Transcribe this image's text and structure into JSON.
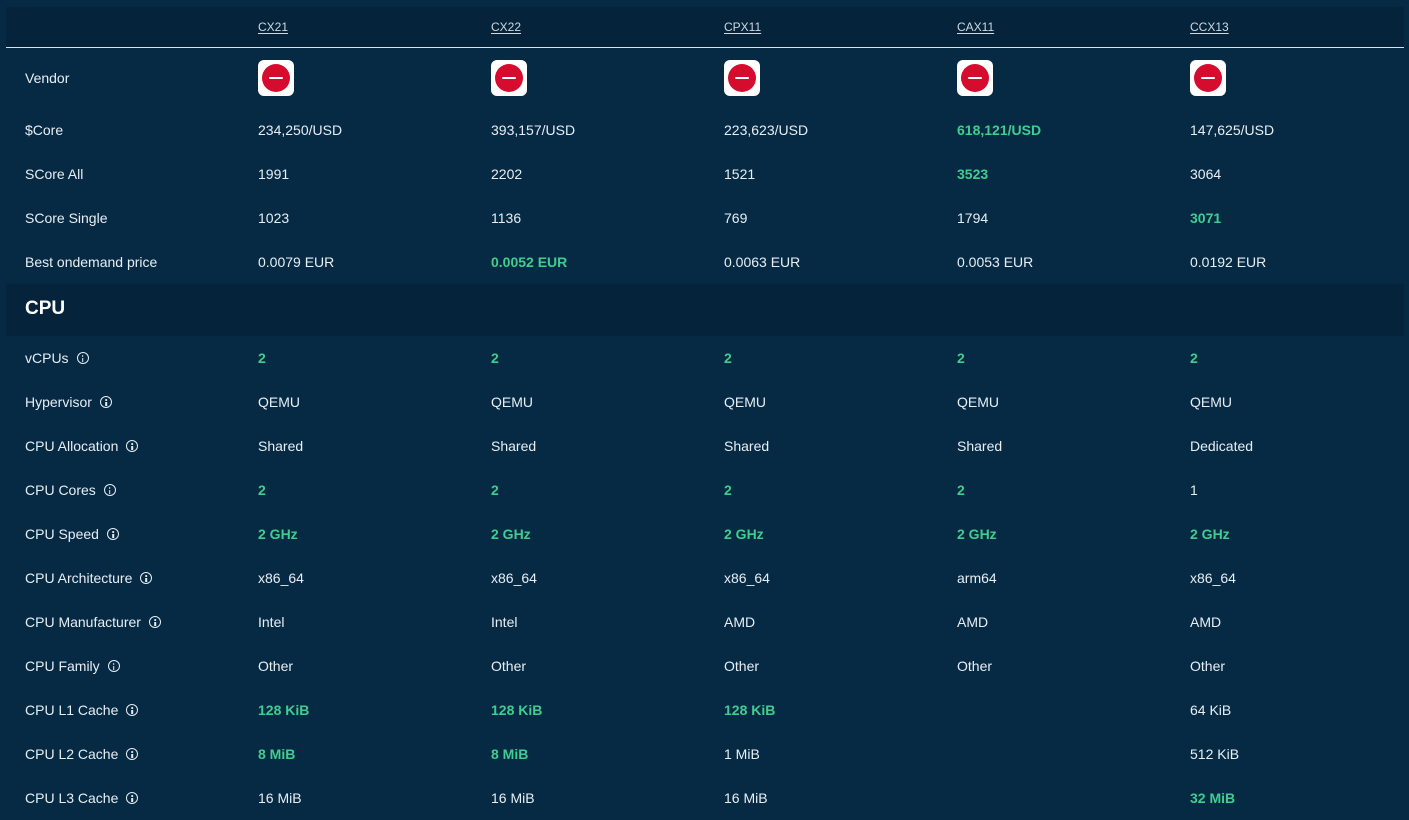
{
  "columns": [
    "CX21",
    "CX22",
    "CPX11",
    "CAX11",
    "CCX13"
  ],
  "vendor": {
    "label": "Vendor",
    "logo": "hetzner-logo",
    "logo_color": "#d50c2d"
  },
  "summary_rows": [
    {
      "label": "$Core",
      "info": false,
      "values": [
        "234,250/USD",
        "393,157/USD",
        "223,623/USD",
        "618,121/USD",
        "147,625/USD"
      ],
      "best": [
        3
      ]
    },
    {
      "label": "SCore All",
      "info": false,
      "values": [
        "1991",
        "2202",
        "1521",
        "3523",
        "3064"
      ],
      "best": [
        3
      ]
    },
    {
      "label": "SCore Single",
      "info": false,
      "values": [
        "1023",
        "1136",
        "769",
        "1794",
        "3071"
      ],
      "best": [
        4
      ]
    },
    {
      "label": "Best ondemand price",
      "info": false,
      "values": [
        "0.0079 EUR",
        "0.0052 EUR",
        "0.0063 EUR",
        "0.0053 EUR",
        "0.0192 EUR"
      ],
      "best": [
        1
      ]
    }
  ],
  "section": {
    "title": "CPU"
  },
  "cpu_rows": [
    {
      "label": "vCPUs",
      "info": true,
      "values": [
        "2",
        "2",
        "2",
        "2",
        "2"
      ],
      "best": [
        0,
        1,
        2,
        3,
        4
      ]
    },
    {
      "label": "Hypervisor",
      "info": true,
      "values": [
        "QEMU",
        "QEMU",
        "QEMU",
        "QEMU",
        "QEMU"
      ],
      "best": []
    },
    {
      "label": "CPU Allocation",
      "info": true,
      "values": [
        "Shared",
        "Shared",
        "Shared",
        "Shared",
        "Dedicated"
      ],
      "best": []
    },
    {
      "label": "CPU Cores",
      "info": true,
      "values": [
        "2",
        "2",
        "2",
        "2",
        "1"
      ],
      "best": [
        0,
        1,
        2,
        3
      ]
    },
    {
      "label": "CPU Speed",
      "info": true,
      "values": [
        "2 GHz",
        "2 GHz",
        "2 GHz",
        "2 GHz",
        "2 GHz"
      ],
      "best": [
        0,
        1,
        2,
        3,
        4
      ]
    },
    {
      "label": "CPU Architecture",
      "info": true,
      "values": [
        "x86_64",
        "x86_64",
        "x86_64",
        "arm64",
        "x86_64"
      ],
      "best": []
    },
    {
      "label": "CPU Manufacturer",
      "info": true,
      "values": [
        "Intel",
        "Intel",
        "AMD",
        "AMD",
        "AMD"
      ],
      "best": []
    },
    {
      "label": "CPU Family",
      "info": true,
      "values": [
        "Other",
        "Other",
        "Other",
        "Other",
        "Other"
      ],
      "best": []
    },
    {
      "label": "CPU L1 Cache",
      "info": true,
      "values": [
        "128 KiB",
        "128 KiB",
        "128 KiB",
        "",
        "64 KiB"
      ],
      "best": [
        0,
        1,
        2
      ]
    },
    {
      "label": "CPU L2 Cache",
      "info": true,
      "values": [
        "8 MiB",
        "8 MiB",
        "1 MiB",
        "",
        "512 KiB"
      ],
      "best": [
        0,
        1
      ]
    },
    {
      "label": "CPU L3 Cache",
      "info": true,
      "values": [
        "16 MiB",
        "16 MiB",
        "16 MiB",
        "",
        "32 MiB"
      ],
      "best": [
        4
      ]
    }
  ],
  "colors": {
    "background": "#062a44",
    "header_background": "#05233a",
    "best_value": "#3fce8e",
    "text": "#e8eef3"
  }
}
